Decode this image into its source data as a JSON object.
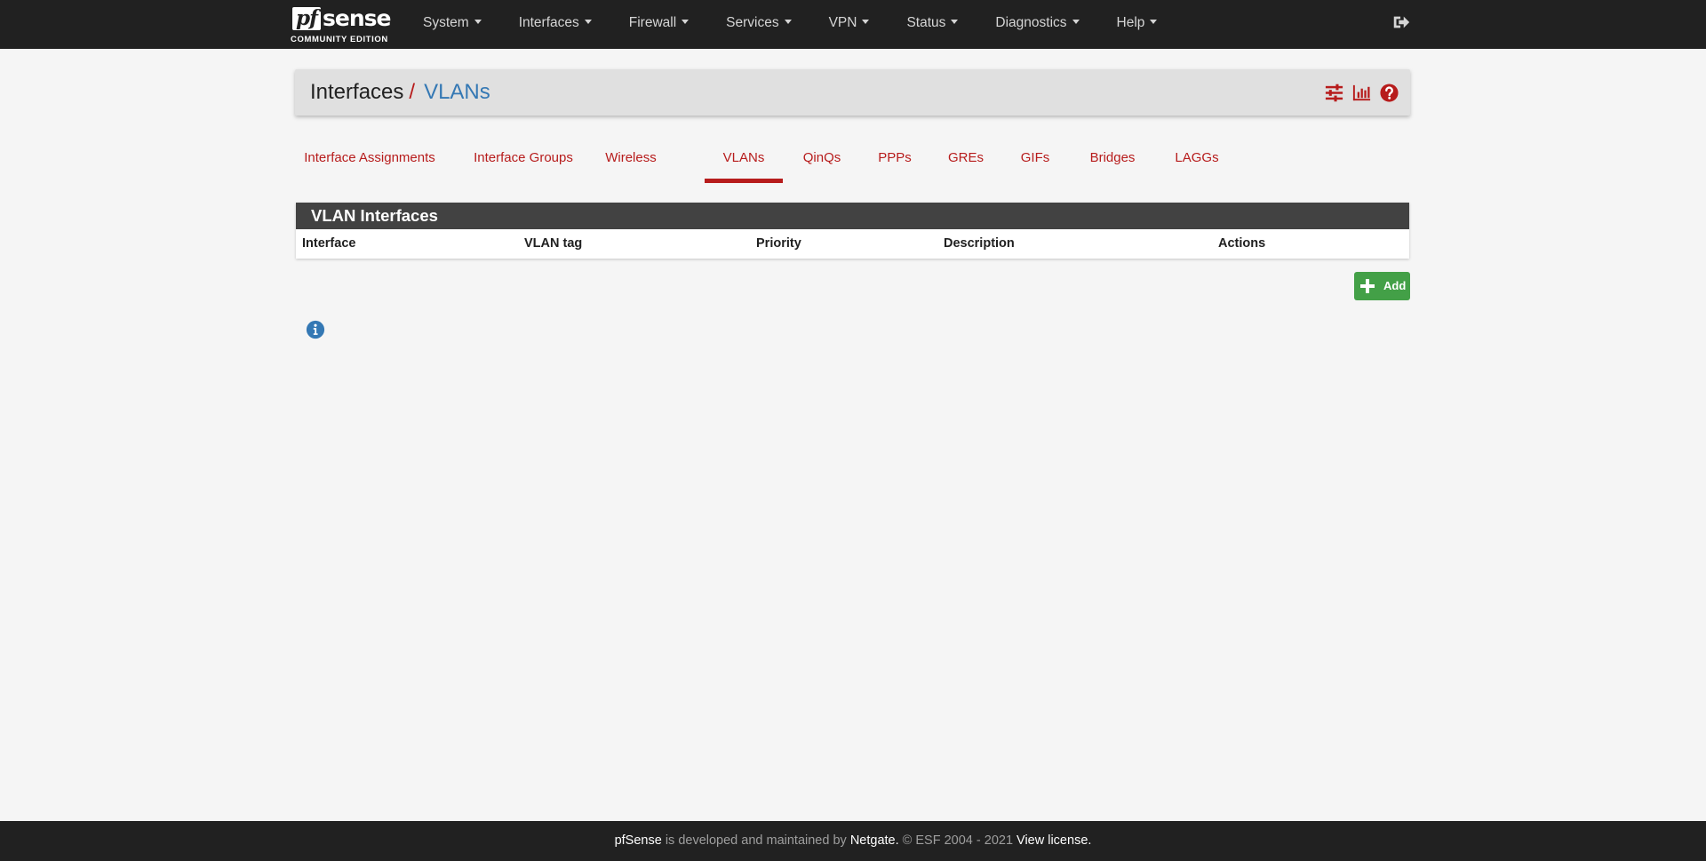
{
  "brand": {
    "logo_pf": "pf",
    "logo_sense": "sense",
    "edition": "COMMUNITY EDITION"
  },
  "nav": {
    "items": [
      {
        "label": "System"
      },
      {
        "label": "Interfaces"
      },
      {
        "label": "Firewall"
      },
      {
        "label": "Services"
      },
      {
        "label": "VPN"
      },
      {
        "label": "Status"
      },
      {
        "label": "Diagnostics"
      },
      {
        "label": "Help"
      }
    ],
    "logout_icon": "sign-out-icon"
  },
  "breadcrumb": {
    "parent": "Interfaces",
    "separator": "/",
    "current": "VLANs",
    "icons": [
      "sliders-icon",
      "bar-chart-icon",
      "question-circle-icon"
    ]
  },
  "tabs": [
    {
      "label": "Interface Assignments"
    },
    {
      "label": "Interface Groups"
    },
    {
      "label": "Wireless"
    },
    {
      "label": "VLANs",
      "active": true
    },
    {
      "label": "QinQs"
    },
    {
      "label": "PPPs"
    },
    {
      "label": "GREs"
    },
    {
      "label": "GIFs"
    },
    {
      "label": "Bridges"
    },
    {
      "label": "LAGGs"
    }
  ],
  "panel": {
    "title": "VLAN Interfaces",
    "columns": [
      "Interface",
      "VLAN tag",
      "Priority",
      "Description",
      "Actions"
    ],
    "rows": []
  },
  "add_button": {
    "label": "Add",
    "icon": "plus-icon"
  },
  "info_icon": "info-circle-icon",
  "footer": {
    "product": "pfSense",
    "text1": "is developed and maintained by",
    "company": "Netgate.",
    "text2": "© ESF 2004 - 2021",
    "license": "View license."
  },
  "colors": {
    "navbar": "#212121",
    "accent_red": "#b71c1c",
    "link_blue": "#3478b4",
    "panel_heading": "#424242",
    "success_green": "#43a047",
    "background": "#f5f5f5"
  }
}
